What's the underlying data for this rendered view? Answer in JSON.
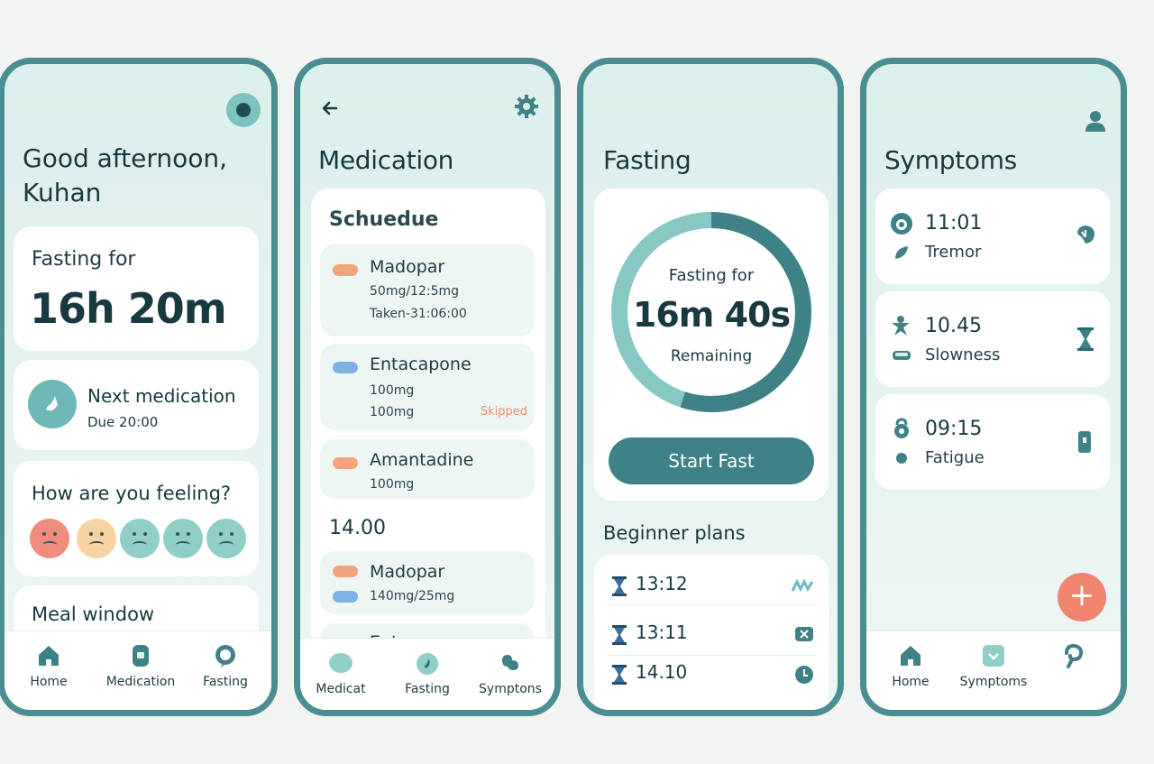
{
  "colors": {
    "teal": "#3e8288",
    "frame": "#4a8d92",
    "accent_orange": "#f0846f",
    "skipped": "#f08a6c"
  },
  "home": {
    "greeting": "Good afternoon,",
    "name": "Kuhan",
    "fasting_label": "Fasting for",
    "fasting_time": "16h 20m",
    "next_med_title": "Next medication",
    "next_med_due": "Due 20:00",
    "feeling_title": "How are you feeling?",
    "moods": [
      "very-sad-face-icon",
      "sad-face-icon",
      "neutral-face-icon",
      "neutral-face-icon",
      "neutral-face-icon"
    ],
    "meal_window": "Meal window",
    "nav": [
      "Home",
      "Medication",
      "Fasting"
    ]
  },
  "medication": {
    "title": "Medication",
    "schedule_title": "Schuedue",
    "items": [
      {
        "name": "Madopar",
        "line1": "50mg/12:5mg",
        "line2": "Taken-31:06:00",
        "pill": "orange"
      },
      {
        "name": "Entacapone",
        "line1": "100mg",
        "line2": "100mg",
        "status": "Skipped",
        "pill": "blue"
      },
      {
        "name": "Amantadine",
        "line1": "100mg",
        "pill": "orange"
      }
    ],
    "time_group": "14.00",
    "group_items": [
      {
        "name": "Madopar",
        "line1": "140mg/25mg"
      },
      {
        "name": "Entcoonong"
      }
    ],
    "nav": [
      "Medicat",
      "Fasting",
      "Symptons"
    ]
  },
  "fasting": {
    "title": "Fasting",
    "ring_label": "Fasting for",
    "ring_time": "16m 40s",
    "ring_sub": "Remaining",
    "progress": 0.55,
    "start_button": "Start Fast",
    "plans_title": "Beginner plans",
    "plans": [
      {
        "time": "13:12",
        "icon": "wave-icon"
      },
      {
        "time": "13:11",
        "icon": "close-box-icon"
      },
      {
        "time": "14.10",
        "icon": "clock-icon"
      }
    ]
  },
  "symptoms": {
    "title": "Symptoms",
    "items": [
      {
        "time": "11:01",
        "name": "Tremor"
      },
      {
        "time": "10.45",
        "name": "Slowness"
      },
      {
        "time": "09:15",
        "name": "Fatigue"
      }
    ],
    "add_label": "+",
    "nav": [
      "Home",
      "Symptoms"
    ]
  }
}
